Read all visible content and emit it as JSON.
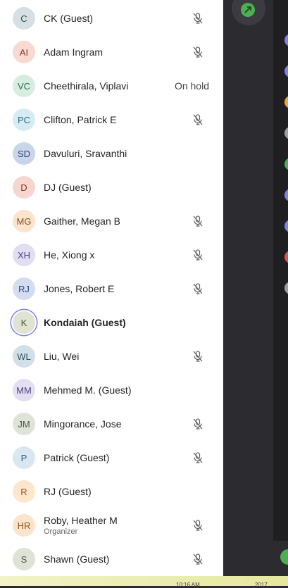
{
  "participants": [
    {
      "initials": "C",
      "name": "CK (Guest)",
      "muted": true,
      "avatar_bg": "#d6e0e4",
      "avatar_fg": "#2f4f5a"
    },
    {
      "initials": "AI",
      "name": "Adam Ingram",
      "muted": true,
      "avatar_bg": "#f9d9d2",
      "avatar_fg": "#8a3a24"
    },
    {
      "initials": "VC",
      "name": "Cheethirala, Viplavi",
      "muted": false,
      "status": "On hold",
      "avatar_bg": "#d7ede1",
      "avatar_fg": "#2e6e4e"
    },
    {
      "initials": "PC",
      "name": "Clifton, Patrick E",
      "muted": true,
      "avatar_bg": "#d5ecf3",
      "avatar_fg": "#2b6a82"
    },
    {
      "initials": "SD",
      "name": "Davuluri, Sravanthi",
      "muted": false,
      "avatar_bg": "#c9d6ea",
      "avatar_fg": "#2b4677"
    },
    {
      "initials": "D",
      "name": "DJ (Guest)",
      "muted": false,
      "avatar_bg": "#f6d6cf",
      "avatar_fg": "#8e3522"
    },
    {
      "initials": "MG",
      "name": "Gaither, Megan B",
      "muted": true,
      "avatar_bg": "#fbe3cc",
      "avatar_fg": "#8a5321"
    },
    {
      "initials": "XH",
      "name": "He, Xiong x",
      "muted": true,
      "avatar_bg": "#e1ddf2",
      "avatar_fg": "#4b3f86"
    },
    {
      "initials": "RJ",
      "name": "Jones, Robert E",
      "muted": true,
      "avatar_bg": "#d4dcef",
      "avatar_fg": "#2c4a86"
    },
    {
      "initials": "K",
      "name": "Kondaiah (Guest)",
      "muted": false,
      "bold": true,
      "speaking": true,
      "avatar_bg": "#dfe3d4",
      "avatar_fg": "#4e5636"
    },
    {
      "initials": "WL",
      "name": "Liu, Wei",
      "muted": true,
      "avatar_bg": "#d3dfe7",
      "avatar_fg": "#2d4e64"
    },
    {
      "initials": "MM",
      "name": "Mehmed M. (Guest)",
      "muted": false,
      "avatar_bg": "#e3def2",
      "avatar_fg": "#4f4486"
    },
    {
      "initials": "JM",
      "name": "Mingorance, Jose",
      "muted": true,
      "avatar_bg": "#dfe4d9",
      "avatar_fg": "#4c5a42"
    },
    {
      "initials": "P",
      "name": "Patrick (Guest)",
      "muted": true,
      "avatar_bg": "#d9e8f0",
      "avatar_fg": "#2f5d77"
    },
    {
      "initials": "R",
      "name": "RJ (Guest)",
      "muted": false,
      "avatar_bg": "#fde6cc",
      "avatar_fg": "#91571c"
    },
    {
      "initials": "HR",
      "name": "Roby, Heather M",
      "role": "Organizer",
      "muted": true,
      "avatar_bg": "#fce3cb",
      "avatar_fg": "#8c531d"
    },
    {
      "initials": "S",
      "name": "Shawn (Guest)",
      "muted": true,
      "avatar_bg": "#dfe3d6",
      "avatar_fg": "#4f5840"
    }
  ],
  "side_dots": [
    "#7b83eb",
    "#7b83eb",
    "#f5a623",
    "#9e9e9e",
    "#4caf50",
    "#7b83eb",
    "#7b83eb",
    "#e05252",
    "#9e9e9e"
  ],
  "taskbar": {
    "time": "10:16 AM",
    "date": "2017"
  }
}
